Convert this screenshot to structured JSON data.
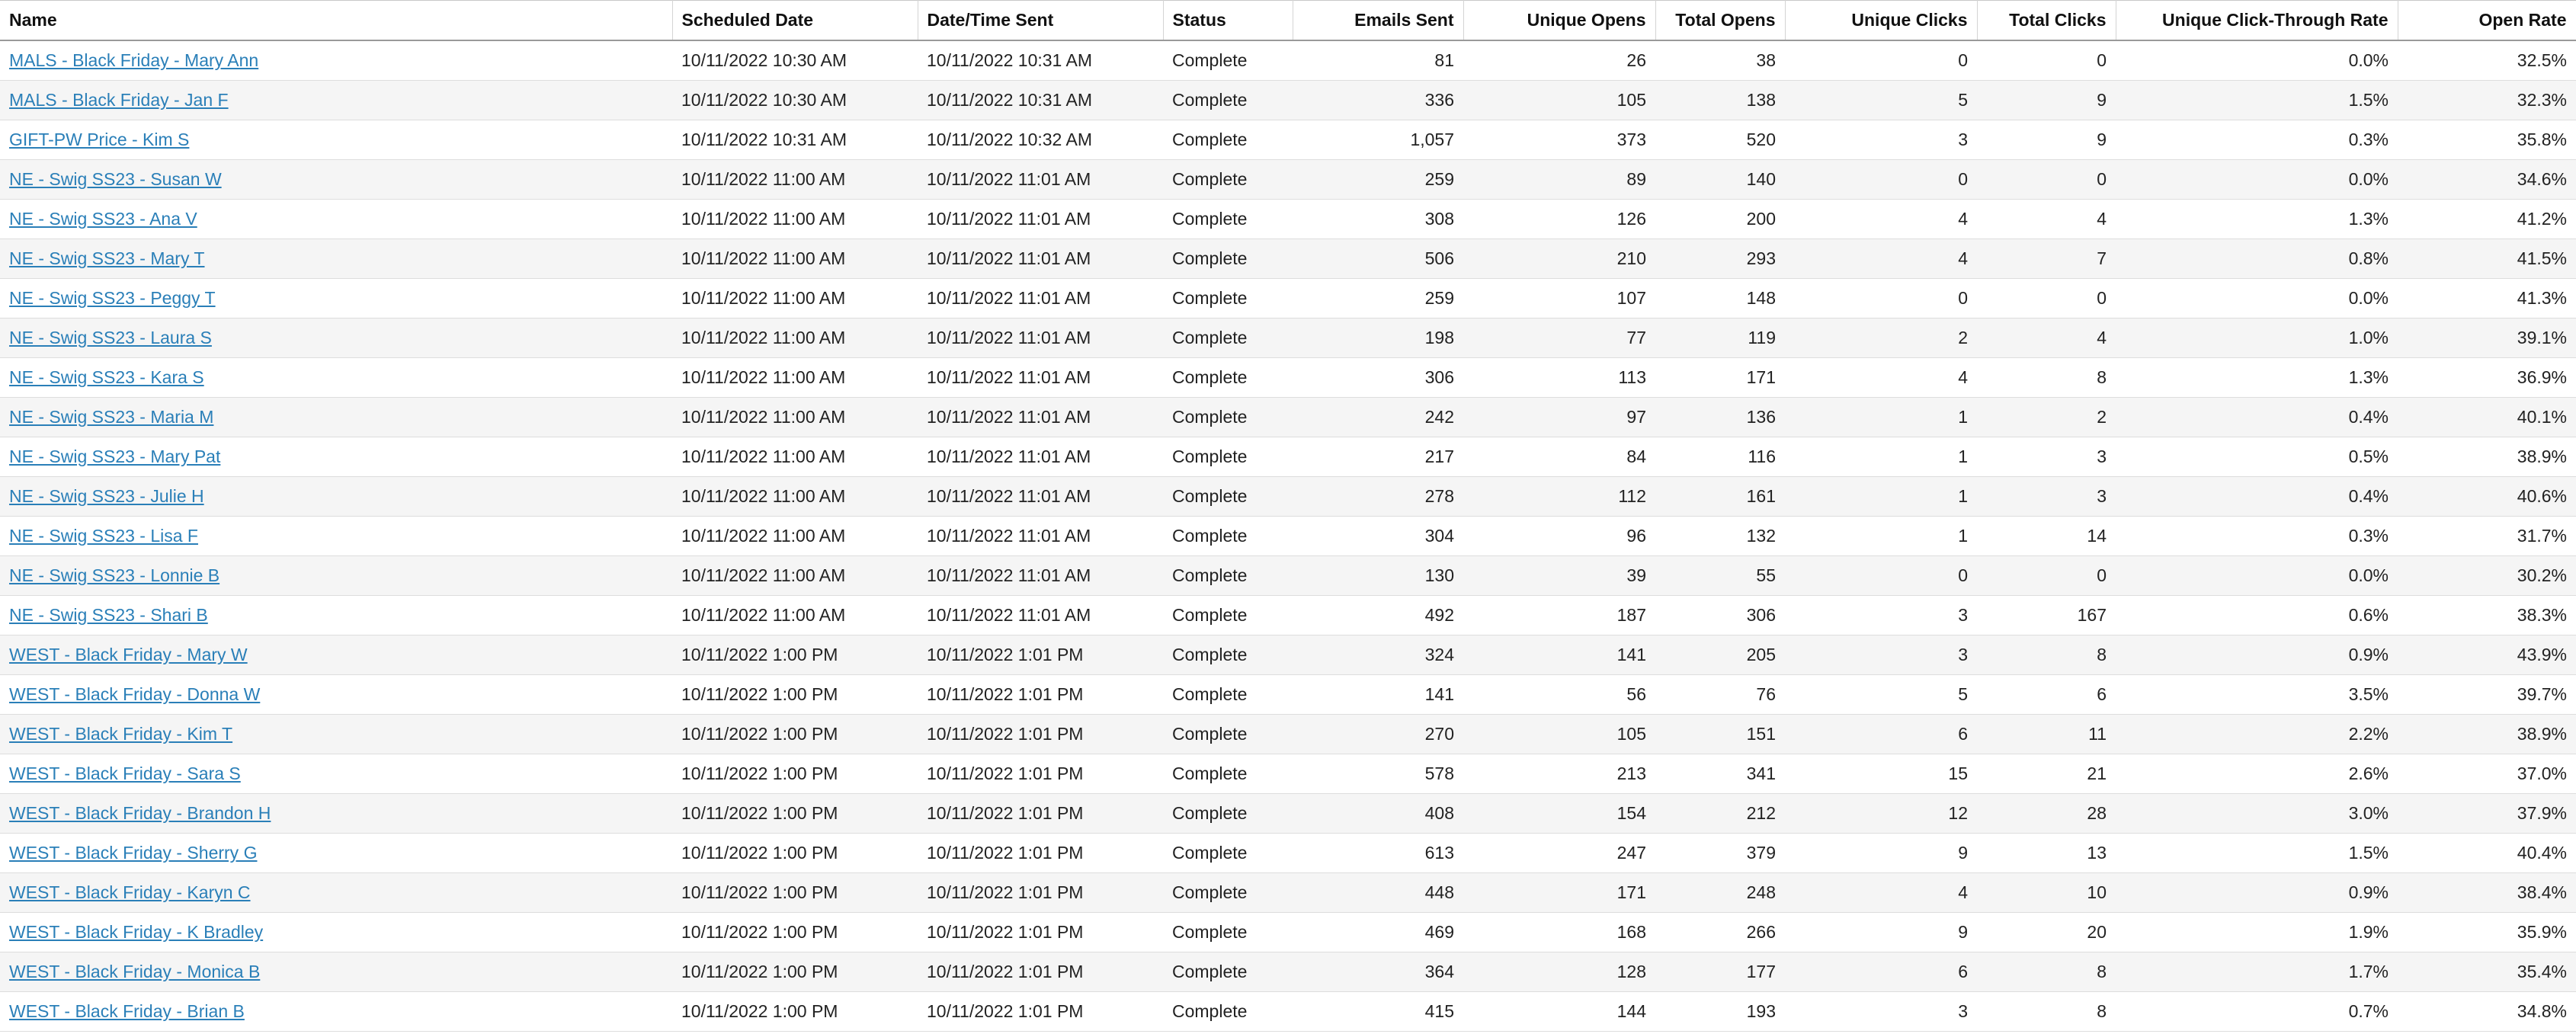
{
  "table": {
    "columns": [
      {
        "label": "Name",
        "align": "left"
      },
      {
        "label": "Scheduled Date",
        "align": "left"
      },
      {
        "label": "Date/Time Sent",
        "align": "left"
      },
      {
        "label": "Status",
        "align": "left"
      },
      {
        "label": "Emails Sent",
        "align": "right"
      },
      {
        "label": "Unique Opens",
        "align": "right"
      },
      {
        "label": "Total Opens",
        "align": "right"
      },
      {
        "label": "Unique Clicks",
        "align": "right"
      },
      {
        "label": "Total Clicks",
        "align": "right"
      },
      {
        "label": "Unique Click-Through Rate",
        "align": "right"
      },
      {
        "label": "Open Rate",
        "align": "right"
      }
    ],
    "rows": [
      [
        "MALS - Black Friday - Mary Ann",
        "10/11/2022 10:30 AM",
        "10/11/2022 10:31 AM",
        "Complete",
        "81",
        "26",
        "38",
        "0",
        "0",
        "0.0%",
        "32.5%"
      ],
      [
        "MALS - Black Friday - Jan F",
        "10/11/2022 10:30 AM",
        "10/11/2022 10:31 AM",
        "Complete",
        "336",
        "105",
        "138",
        "5",
        "9",
        "1.5%",
        "32.3%"
      ],
      [
        "GIFT-PW Price - Kim S",
        "10/11/2022 10:31 AM",
        "10/11/2022 10:32 AM",
        "Complete",
        "1,057",
        "373",
        "520",
        "3",
        "9",
        "0.3%",
        "35.8%"
      ],
      [
        "NE - Swig SS23 - Susan W",
        "10/11/2022 11:00 AM",
        "10/11/2022 11:01 AM",
        "Complete",
        "259",
        "89",
        "140",
        "0",
        "0",
        "0.0%",
        "34.6%"
      ],
      [
        "NE - Swig SS23 - Ana V",
        "10/11/2022 11:00 AM",
        "10/11/2022 11:01 AM",
        "Complete",
        "308",
        "126",
        "200",
        "4",
        "4",
        "1.3%",
        "41.2%"
      ],
      [
        "NE - Swig SS23 - Mary T",
        "10/11/2022 11:00 AM",
        "10/11/2022 11:01 AM",
        "Complete",
        "506",
        "210",
        "293",
        "4",
        "7",
        "0.8%",
        "41.5%"
      ],
      [
        "NE - Swig SS23 - Peggy T",
        "10/11/2022 11:00 AM",
        "10/11/2022 11:01 AM",
        "Complete",
        "259",
        "107",
        "148",
        "0",
        "0",
        "0.0%",
        "41.3%"
      ],
      [
        "NE - Swig SS23 - Laura S",
        "10/11/2022 11:00 AM",
        "10/11/2022 11:01 AM",
        "Complete",
        "198",
        "77",
        "119",
        "2",
        "4",
        "1.0%",
        "39.1%"
      ],
      [
        "NE - Swig SS23 - Kara S",
        "10/11/2022 11:00 AM",
        "10/11/2022 11:01 AM",
        "Complete",
        "306",
        "113",
        "171",
        "4",
        "8",
        "1.3%",
        "36.9%"
      ],
      [
        "NE - Swig SS23 - Maria M",
        "10/11/2022 11:00 AM",
        "10/11/2022 11:01 AM",
        "Complete",
        "242",
        "97",
        "136",
        "1",
        "2",
        "0.4%",
        "40.1%"
      ],
      [
        "NE - Swig SS23 - Mary Pat",
        "10/11/2022 11:00 AM",
        "10/11/2022 11:01 AM",
        "Complete",
        "217",
        "84",
        "116",
        "1",
        "3",
        "0.5%",
        "38.9%"
      ],
      [
        "NE - Swig SS23 - Julie H",
        "10/11/2022 11:00 AM",
        "10/11/2022 11:01 AM",
        "Complete",
        "278",
        "112",
        "161",
        "1",
        "3",
        "0.4%",
        "40.6%"
      ],
      [
        "NE - Swig SS23 - Lisa F",
        "10/11/2022 11:00 AM",
        "10/11/2022 11:01 AM",
        "Complete",
        "304",
        "96",
        "132",
        "1",
        "14",
        "0.3%",
        "31.7%"
      ],
      [
        "NE - Swig SS23 - Lonnie B",
        "10/11/2022 11:00 AM",
        "10/11/2022 11:01 AM",
        "Complete",
        "130",
        "39",
        "55",
        "0",
        "0",
        "0.0%",
        "30.2%"
      ],
      [
        "NE - Swig SS23 - Shari B",
        "10/11/2022 11:00 AM",
        "10/11/2022 11:01 AM",
        "Complete",
        "492",
        "187",
        "306",
        "3",
        "167",
        "0.6%",
        "38.3%"
      ],
      [
        "WEST - Black Friday - Mary W",
        "10/11/2022 1:00 PM",
        "10/11/2022 1:01 PM",
        "Complete",
        "324",
        "141",
        "205",
        "3",
        "8",
        "0.9%",
        "43.9%"
      ],
      [
        "WEST - Black Friday - Donna W",
        "10/11/2022 1:00 PM",
        "10/11/2022 1:01 PM",
        "Complete",
        "141",
        "56",
        "76",
        "5",
        "6",
        "3.5%",
        "39.7%"
      ],
      [
        "WEST - Black Friday - Kim T",
        "10/11/2022 1:00 PM",
        "10/11/2022 1:01 PM",
        "Complete",
        "270",
        "105",
        "151",
        "6",
        "11",
        "2.2%",
        "38.9%"
      ],
      [
        "WEST - Black Friday - Sara S",
        "10/11/2022 1:00 PM",
        "10/11/2022 1:01 PM",
        "Complete",
        "578",
        "213",
        "341",
        "15",
        "21",
        "2.6%",
        "37.0%"
      ],
      [
        "WEST - Black Friday - Brandon H",
        "10/11/2022 1:00 PM",
        "10/11/2022 1:01 PM",
        "Complete",
        "408",
        "154",
        "212",
        "12",
        "28",
        "3.0%",
        "37.9%"
      ],
      [
        "WEST - Black Friday - Sherry G",
        "10/11/2022 1:00 PM",
        "10/11/2022 1:01 PM",
        "Complete",
        "613",
        "247",
        "379",
        "9",
        "13",
        "1.5%",
        "40.4%"
      ],
      [
        "WEST - Black Friday - Karyn C",
        "10/11/2022 1:00 PM",
        "10/11/2022 1:01 PM",
        "Complete",
        "448",
        "171",
        "248",
        "4",
        "10",
        "0.9%",
        "38.4%"
      ],
      [
        "WEST - Black Friday - K Bradley",
        "10/11/2022 1:00 PM",
        "10/11/2022 1:01 PM",
        "Complete",
        "469",
        "168",
        "266",
        "9",
        "20",
        "1.9%",
        "35.9%"
      ],
      [
        "WEST - Black Friday - Monica B",
        "10/11/2022 1:00 PM",
        "10/11/2022 1:01 PM",
        "Complete",
        "364",
        "128",
        "177",
        "6",
        "8",
        "1.7%",
        "35.4%"
      ],
      [
        "WEST - Black Friday - Brian B",
        "10/11/2022 1:00 PM",
        "10/11/2022 1:01 PM",
        "Complete",
        "415",
        "144",
        "193",
        "3",
        "8",
        "0.7%",
        "34.8%"
      ]
    ]
  }
}
